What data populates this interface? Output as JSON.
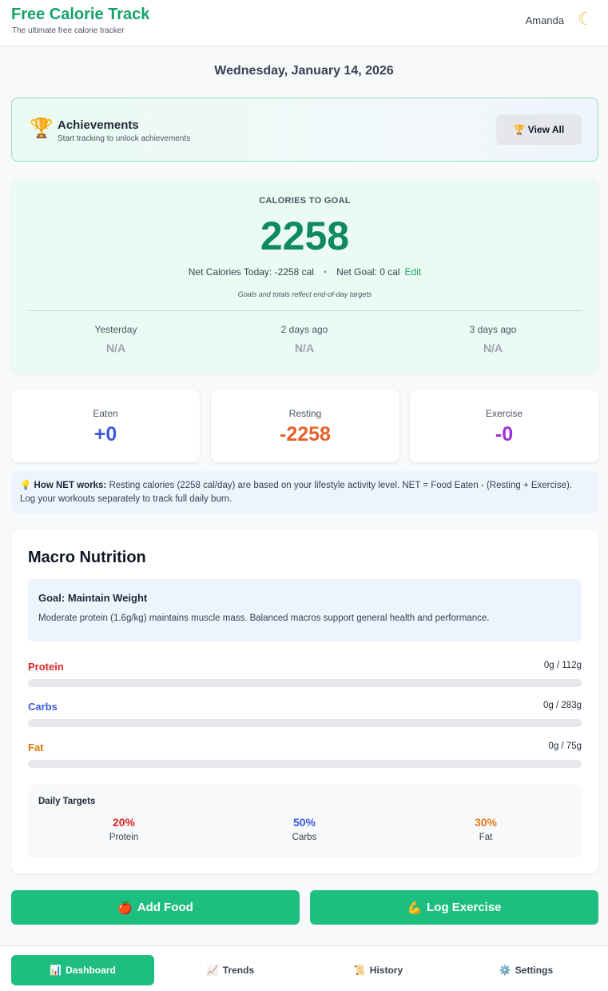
{
  "header": {
    "app_title": "Free Calorie Track",
    "tagline": "The ultimate free calorie tracker",
    "user_name": "Amanda",
    "theme_icon": "☾"
  },
  "date": "Wednesday, January 14, 2026",
  "achievements": {
    "icon": "🏆",
    "title": "Achievements",
    "subtitle": "Start tracking to unlock achievements",
    "button_icon": "🏆",
    "button_label": "View All"
  },
  "goal": {
    "label": "CALORIES TO GOAL",
    "value": "2258",
    "net_today": "Net Calories Today: -2258 cal",
    "separator": "•",
    "net_goal": "Net Goal: 0 cal",
    "edit_label": "Edit",
    "note": "Goals and totals reflect end-of-day targets",
    "history": [
      {
        "label": "Yesterday",
        "value": "N/A"
      },
      {
        "label": "2 days ago",
        "value": "N/A"
      },
      {
        "label": "3 days ago",
        "value": "N/A"
      }
    ]
  },
  "stats": [
    {
      "label": "Eaten",
      "value": "+0",
      "color": "#3b5bdb"
    },
    {
      "label": "Resting",
      "value": "-2258",
      "color": "#e8602c"
    },
    {
      "label": "Exercise",
      "value": "-0",
      "color": "#9b30d9"
    }
  ],
  "info": {
    "icon": "💡",
    "bold": "How NET works:",
    "text": " Resting calories (2258 cal/day) are based on your lifestyle activity level. NET = Food Eaten - (Resting + Exercise). Log your workouts separately to track full daily burn."
  },
  "macro": {
    "title": "Macro Nutrition",
    "goal_title": "Goal: Maintain Weight",
    "goal_desc": "Moderate protein (1.6g/kg) maintains muscle mass. Balanced macros support general health and performance.",
    "rows": [
      {
        "name": "Protein",
        "amount": "0g / 112g",
        "progress": 0,
        "color": "#dc2626"
      },
      {
        "name": "Carbs",
        "amount": "0g / 283g",
        "progress": 0,
        "color": "#3b5bdb"
      },
      {
        "name": "Fat",
        "amount": "0g / 75g",
        "progress": 0,
        "color": "#d97706"
      }
    ],
    "targets_title": "Daily Targets",
    "targets": [
      {
        "pct": "20%",
        "name": "Protein",
        "color": "#dc2626"
      },
      {
        "pct": "50%",
        "name": "Carbs",
        "color": "#3b5bdb"
      },
      {
        "pct": "30%",
        "name": "Fat",
        "color": "#e07b1a"
      }
    ]
  },
  "actions": {
    "add_food_icon": "🍎",
    "add_food": "Add Food",
    "log_exercise_icon": "💪",
    "log_exercise": "Log Exercise"
  },
  "nav": [
    {
      "icon": "📊",
      "label": "Dashboard",
      "active": true
    },
    {
      "icon": "📈",
      "label": "Trends",
      "active": false
    },
    {
      "icon": "📜",
      "label": "History",
      "active": false
    },
    {
      "icon": "⚙️",
      "label": "Settings",
      "active": false
    }
  ],
  "colors": {
    "brand": "#16a36a",
    "accent_button": "#1ebd80",
    "goal_value": "#0f8a5f"
  }
}
